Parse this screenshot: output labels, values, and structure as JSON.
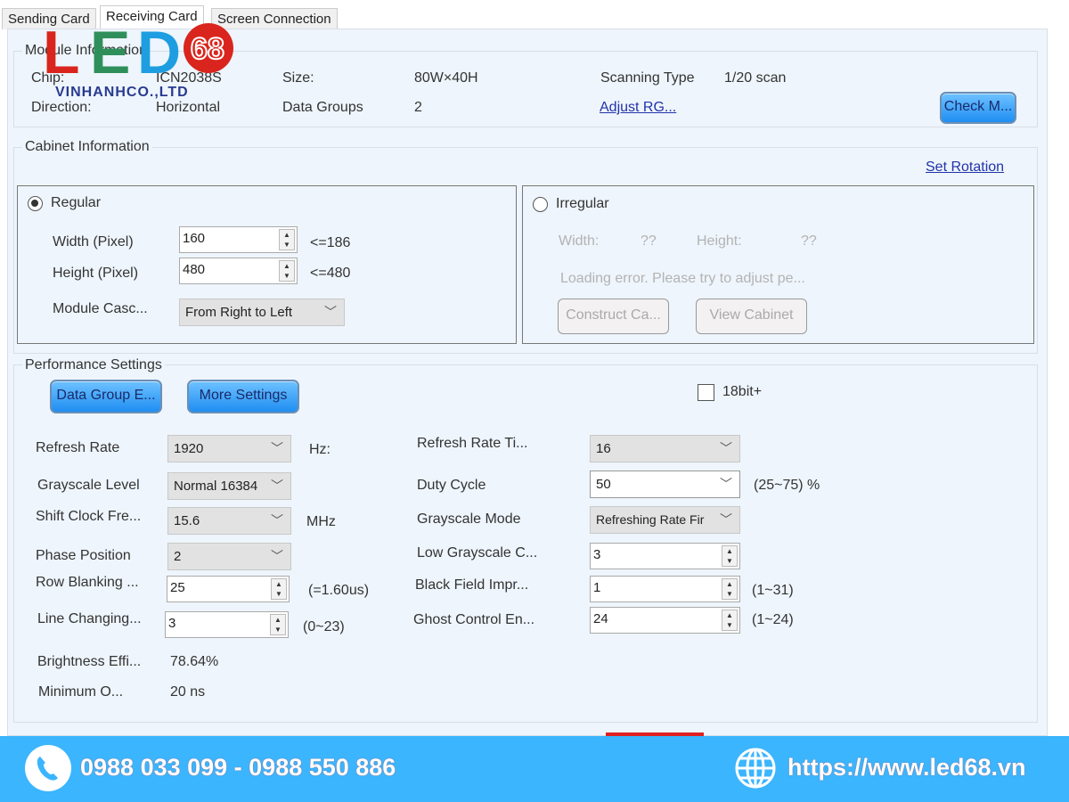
{
  "tabs": [
    {
      "label": "Sending Card"
    },
    {
      "label": "Receiving Card"
    },
    {
      "label": "Screen Connection"
    }
  ],
  "logo": {
    "text": "LED68",
    "subtext": "VINHANHCO.,LTD"
  },
  "module": {
    "title": "Module Information",
    "chip_label": "Chip:",
    "chip": "ICN2038S",
    "size_label": "Size:",
    "size": "80W×40H",
    "scan_label": "Scanning Type",
    "scan": "1/20 scan",
    "direction_label": "Direction:",
    "direction": "Horizontal",
    "groups_label": "Data Groups",
    "groups": "2",
    "adjust_link": "Adjust RG...",
    "check_button": "Check M..."
  },
  "cabinet": {
    "title": "Cabinet Information",
    "set_rotation": "Set Rotation",
    "regular": {
      "label": "Regular",
      "width_label": "Width (Pixel)",
      "width": "160",
      "width_max": "<=186",
      "height_label": "Height (Pixel)",
      "height": "480",
      "height_max": "<=480",
      "cascade_label": "Module Casc...",
      "cascade": "From Right to Left"
    },
    "irregular": {
      "label": "Irregular",
      "width_label": "Width:",
      "width": "??",
      "height_label": "Height:",
      "height": "??",
      "error": "Loading error. Please try to adjust pe...",
      "construct_button": "Construct Ca...",
      "view_button": "View Cabinet"
    }
  },
  "performance": {
    "title": "Performance Settings",
    "data_group_button": "Data Group E...",
    "more_button": "More Settings",
    "bit18": "18bit+",
    "refresh_label": "Refresh Rate",
    "refresh": "1920",
    "refresh_unit": "Hz:",
    "gray_label": "Grayscale Level",
    "gray": "Normal 16384",
    "shift_label": "Shift Clock Fre...",
    "shift": "15.6",
    "shift_unit": "MHz",
    "phase_label": "Phase Position",
    "phase": "2",
    "row_label": "Row Blanking ...",
    "row": "25",
    "row_note": "(=1.60us)",
    "line_label": "Line Changing...",
    "line": "3",
    "line_note": "(0~23)",
    "bright_label": "Brightness Effi...",
    "bright": "78.64%",
    "min_label": "Minimum O...",
    "min": "20 ns",
    "rrt_label": "Refresh Rate Ti...",
    "rrt": "16",
    "duty_label": "Duty Cycle",
    "duty": "50",
    "duty_note": "(25~75) %",
    "gmode_label": "Grayscale Mode",
    "gmode": "Refreshing Rate Fir",
    "lowgray_label": "Low Grayscale C...",
    "lowgray": "3",
    "black_label": "Black Field Impr...",
    "black": "1",
    "black_note": "(1~31)",
    "ghost_label": "Ghost Control En...",
    "ghost": "24",
    "ghost_note": "(1~24)"
  },
  "footer": {
    "phone": "0988 033 099 - 0988 550 886",
    "website": "https://www.led68.vn"
  },
  "colors": {
    "footer": "#3bb5fd",
    "panel": "#eef5fc",
    "button": "#1f8ef2"
  }
}
